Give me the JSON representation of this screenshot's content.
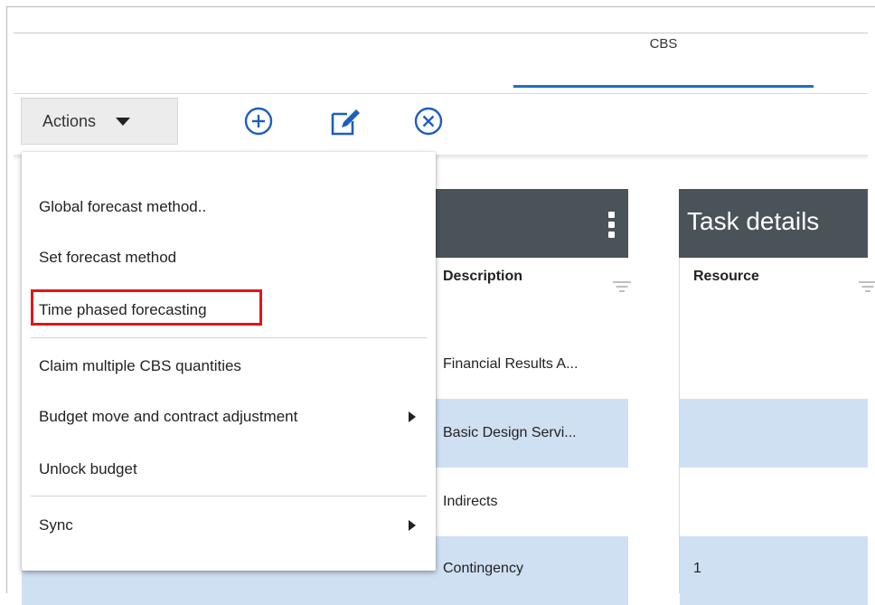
{
  "tabs": [
    {
      "label": "CBS",
      "active": true
    }
  ],
  "toolbar": {
    "actions_label": "Actions",
    "icons": [
      "add-circle-icon",
      "edit-icon",
      "remove-circle-icon"
    ],
    "accent_color": "#1d6fc4"
  },
  "panels": {
    "cbs_panel": {
      "columns": [
        {
          "label": "Description"
        }
      ],
      "rows": [
        "Financial Results A...",
        "Basic Design Servi...",
        "Indirects",
        "Contingency"
      ]
    },
    "task_panel": {
      "title": "Task details",
      "columns": [
        {
          "label": "Resource"
        }
      ],
      "rows": [
        "",
        "",
        "",
        "1"
      ]
    }
  },
  "menu": {
    "items": [
      {
        "label": "Global forecast method..",
        "has_submenu": false
      },
      {
        "label": "Set forecast method",
        "has_submenu": false
      },
      {
        "label": "Time phased forecasting",
        "has_submenu": false,
        "highlighted": true
      },
      {
        "label": "Claim multiple CBS quantities",
        "has_submenu": false
      },
      {
        "label": "Budget move and contract adjustment",
        "has_submenu": true
      },
      {
        "label": "Unlock budget",
        "has_submenu": false
      },
      {
        "label": "Sync",
        "has_submenu": true
      }
    ],
    "highlight_color": "#e0161b"
  }
}
